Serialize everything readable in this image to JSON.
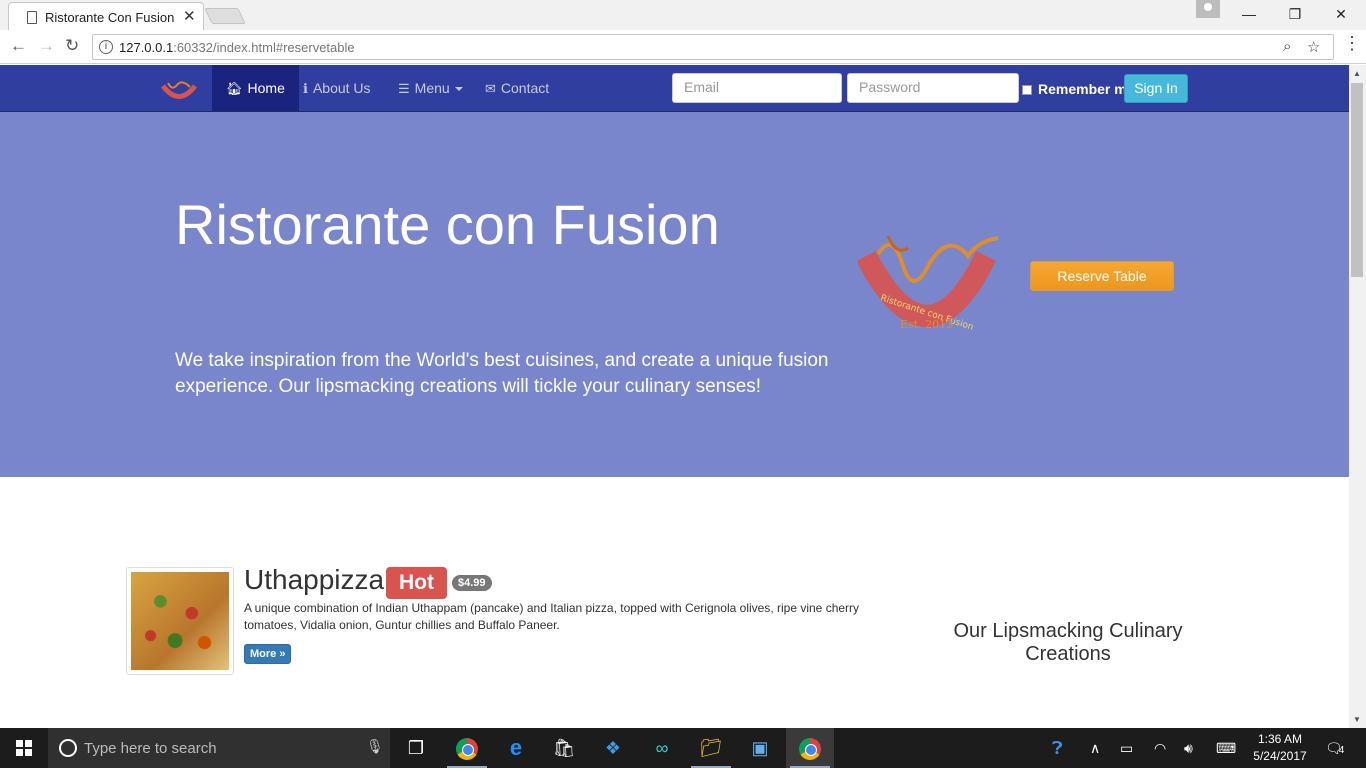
{
  "browser": {
    "tab_title": "Ristorante Con Fusion",
    "url_host": "127.0.0.1",
    "url_rest": ":60332/index.html#reservetable"
  },
  "navbar": {
    "home": "Home",
    "about": "About Us",
    "menu": "Menu",
    "contact": "Contact",
    "email_placeholder": "Email",
    "password_placeholder": "Password",
    "remember": "Remember me",
    "signin": "Sign In"
  },
  "jumbotron": {
    "title": "Ristorante con Fusion",
    "text": "We take inspiration from the World's best cuisines, and create a unique fusion experience. Our lipsmacking creations will tickle your culinary senses!",
    "logo_text": "Ristorante con Fusion",
    "logo_est": "Est. 2013",
    "reserve": "Reserve Table"
  },
  "featured": {
    "name": "Uthappizza",
    "label": "Hot",
    "price": "$4.99",
    "description": "A unique combination of Indian Uthappam (pancake) and Italian pizza, topped with Cerignola olives, ripe vine cherry tomatoes, Vidalia onion, Guntur chillies and Buffalo Paneer.",
    "more": "More »"
  },
  "side_heading": "Our Lipsmacking Culinary Creations",
  "taskbar": {
    "search_placeholder": "Type here to search",
    "time": "1:36 AM",
    "date": "5/24/2017",
    "notifications": "4"
  },
  "colors": {
    "navbar": "#303f9f",
    "navbar_active": "#1a237e",
    "jumbotron": "#7986cb",
    "reserve": "#f0ad4e",
    "hot_label": "#d9534f",
    "signin": "#46b8da"
  }
}
